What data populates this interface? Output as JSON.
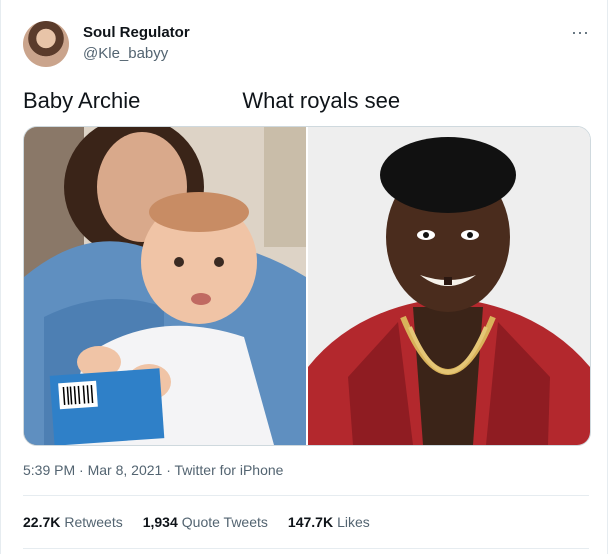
{
  "author": {
    "display_name": "Soul Regulator",
    "handle": "@Kle_babyy"
  },
  "more_icon": "more-horizontal-icon",
  "tweet": {
    "text_left": "Baby Archie",
    "text_right": "What royals see"
  },
  "meta": {
    "time": "5:39 PM",
    "sep1": " · ",
    "date": "Mar 8, 2021",
    "sep2": " · ",
    "source": "Twitter for iPhone"
  },
  "stats": {
    "retweets_count": "22.7K",
    "retweets_label": "Retweets",
    "quotes_count": "1,934",
    "quotes_label": "Quote Tweets",
    "likes_count": "147.7K",
    "likes_label": "Likes"
  },
  "colors": {
    "text": "#0f1419",
    "secondary": "#536471",
    "border": "#e6ecf0"
  }
}
